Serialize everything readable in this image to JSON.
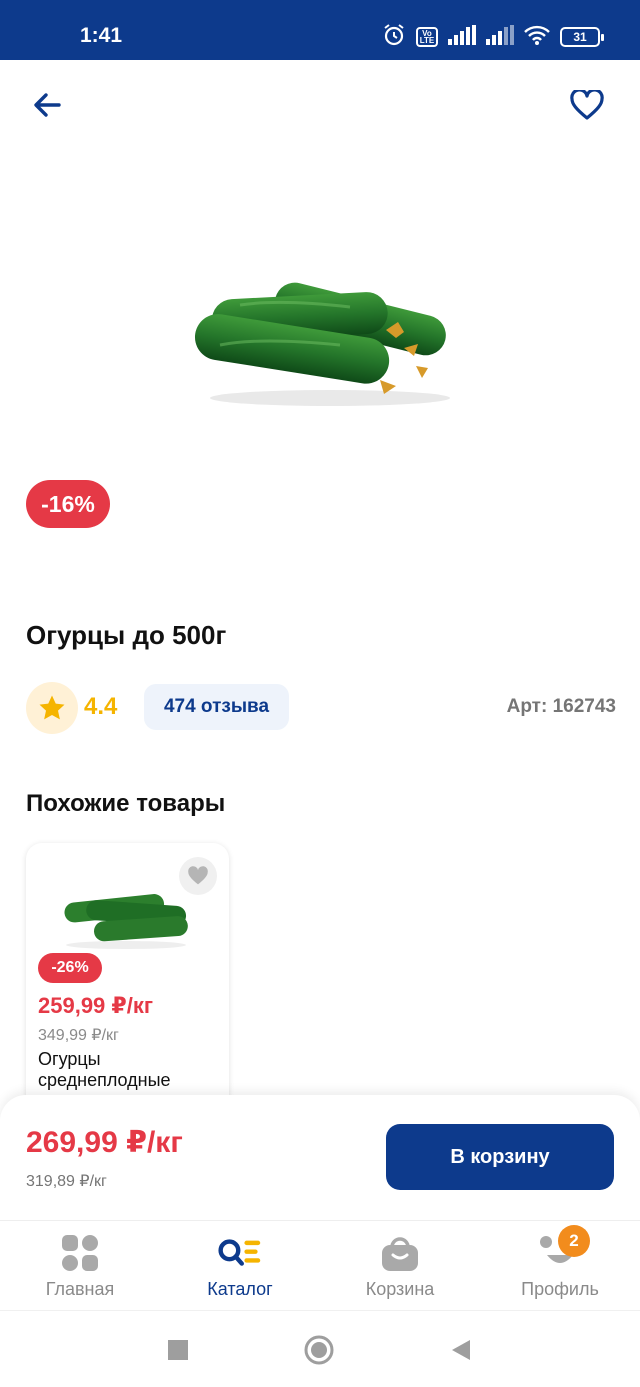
{
  "status_bar": {
    "time": "1:41",
    "battery": "31",
    "volte_top": "Vo",
    "volte_bottom": "LTE",
    "icons": [
      "alarm-icon",
      "volte-icon",
      "signal-icon",
      "signal-icon",
      "wifi-icon",
      "battery-icon"
    ]
  },
  "header": {
    "back_icon": "arrow-left-icon",
    "favorite_icon": "heart-outline-icon"
  },
  "product": {
    "image_icon": "cucumber-image",
    "discount": "-16%",
    "title": "Огурцы до 500г",
    "rating": "4.4",
    "reviews": "474 отзыва",
    "article": "Арт: 162743"
  },
  "similar": {
    "title": "Похожие товары",
    "items": [
      {
        "discount": "-26%",
        "price": "259,99 ₽/кг",
        "old_price": "349,99 ₽/кг",
        "name": "Огурцы среднеплодные"
      }
    ]
  },
  "buy_panel": {
    "price": "269,99 ₽/кг",
    "old_price": "319,89 ₽/кг",
    "cart_button": "В корзину"
  },
  "tabbar": {
    "tabs": [
      {
        "label": "Главная",
        "icon": "home-grid-icon"
      },
      {
        "label": "Каталог",
        "icon": "catalog-search-icon"
      },
      {
        "label": "Корзина",
        "icon": "basket-icon"
      },
      {
        "label": "Профиль",
        "icon": "profile-face-icon",
        "badge": "2"
      }
    ],
    "active": "Каталог"
  },
  "colors": {
    "brand_blue": "#0d3a8c",
    "discount_red": "#e53946",
    "rating_yellow": "#f5b400",
    "badge_orange": "#f28c1d"
  }
}
